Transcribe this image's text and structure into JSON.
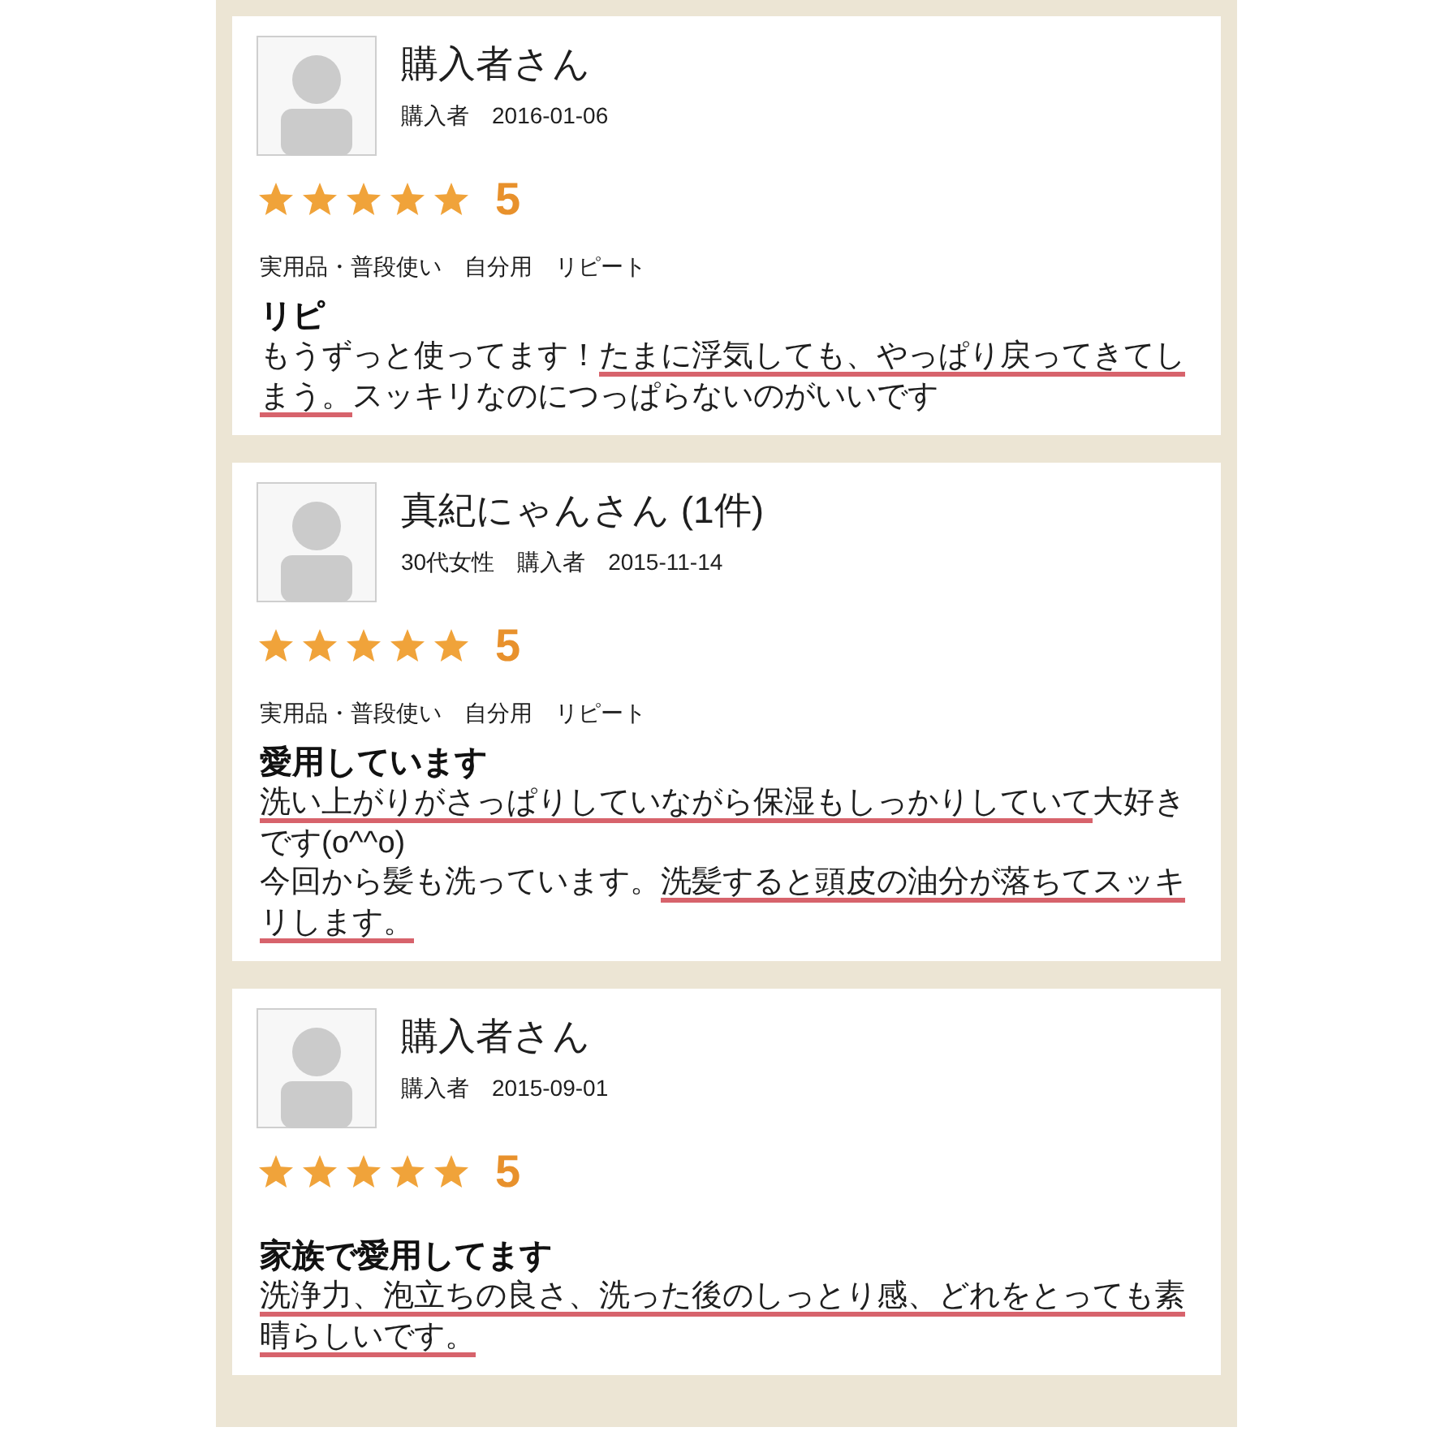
{
  "reviews": [
    {
      "name": "購入者さん",
      "meta": [
        "購入者",
        "2016-01-06"
      ],
      "stars": 5,
      "score": "5",
      "tags": [
        "実用品・普段使い",
        "自分用",
        "リピート"
      ],
      "title": "リピ",
      "body": [
        [
          {
            "text": "もうずっと使ってます！",
            "underlined": false
          },
          {
            "text": "たまに浮気しても、やっぱり戻ってきてしまう。",
            "underlined": true
          },
          {
            "text": "スッキリなのにつっぱらないのがいいです",
            "underlined": false
          }
        ]
      ]
    },
    {
      "name": "真紀にゃんさん (1件)",
      "meta": [
        "30代女性",
        "購入者",
        "2015-11-14"
      ],
      "stars": 5,
      "score": "5",
      "tags": [
        "実用品・普段使い",
        "自分用",
        "リピート"
      ],
      "title": "愛用しています",
      "body": [
        [
          {
            "text": "洗い上がりがさっぱりしていながら保湿もしっかりしていて",
            "underlined": true
          },
          {
            "text": "大好きです(o^^o)",
            "underlined": false
          }
        ],
        [
          {
            "text": "今回から髪も洗っています。",
            "underlined": false
          },
          {
            "text": "洗髪すると頭皮の油分が落ちてスッキリします。",
            "underlined": true
          }
        ]
      ]
    },
    {
      "name": "購入者さん",
      "meta": [
        "購入者",
        "2015-09-01"
      ],
      "stars": 5,
      "score": "5",
      "title": "家族で愛用してます",
      "body": [
        [
          {
            "text": "洗浄力、泡立ちの良さ、洗った後のしっとり感、どれをとっても素晴らしいです。",
            "underlined": true
          }
        ]
      ]
    }
  ]
}
